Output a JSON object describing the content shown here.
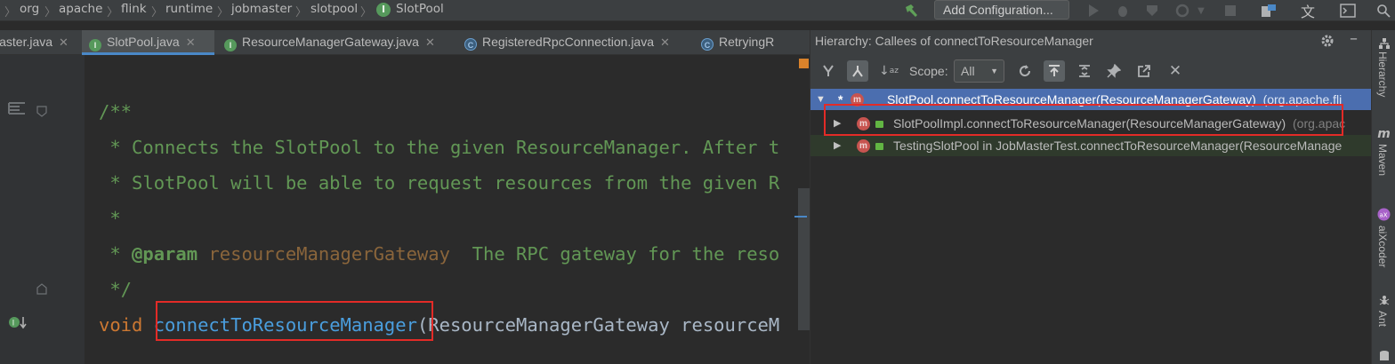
{
  "breadcrumb": {
    "items": [
      "org",
      "apache",
      "flink",
      "runtime",
      "jobmaster",
      "slotpool"
    ],
    "current": "SlotPool"
  },
  "toolbar": {
    "add_configuration_label": "Add Configuration..."
  },
  "editor_tabs": [
    {
      "label": "Master.java",
      "partial": "laster.java",
      "icon": "java-class-icon",
      "active": false
    },
    {
      "label": "SlotPool.java",
      "icon": "interface-icon",
      "active": true
    },
    {
      "label": "ResourceManagerGateway.java",
      "icon": "interface-icon",
      "active": false
    },
    {
      "label": "RegisteredRpcConnection.java",
      "icon": "abstract-class-icon",
      "active": false
    },
    {
      "label": "RetryingR",
      "icon": "abstract-class-icon",
      "active": false
    }
  ],
  "code": {
    "line1": "/**",
    "line2": " * Connects the SlotPool to the given ResourceManager. After t",
    "line3": " * SlotPool will be able to request resources from the given R",
    "line4": " *",
    "line5_star": " * ",
    "line5_tag": "@param",
    "line5_param": " resourceManagerGateway",
    "line5_desc": "  The RPC gateway for the reso",
    "line6": " */",
    "line7_kw": "void ",
    "line7_fn": "connectToResourceManager",
    "line7_rest": "(ResourceManagerGateway resourceM"
  },
  "hierarchy": {
    "title": "Hierarchy:  Callees of connectToResourceManager",
    "scope_label": "Scope:",
    "scope_value": "All",
    "rows": [
      {
        "text": "SlotPool.connectToResourceManager(ResourceManagerGateway)",
        "extra": "(org.apache.fli",
        "selected": true
      },
      {
        "text": "SlotPoolImpl.connectToResourceManager(ResourceManagerGateway)",
        "extra": "(org.apac",
        "selected": false
      },
      {
        "text": "TestingSlotPool in JobMasterTest.connectToResourceManager(ResourceManage",
        "extra": "",
        "selected": false
      }
    ]
  },
  "side_tools": [
    "Hierarchy",
    "Maven",
    "aiXcoder",
    "Ant"
  ],
  "colors": {
    "highlight_box": "#e32b27",
    "selection": "#4b6eaf",
    "keyword": "#cc7832",
    "doc_comment": "#629755"
  }
}
